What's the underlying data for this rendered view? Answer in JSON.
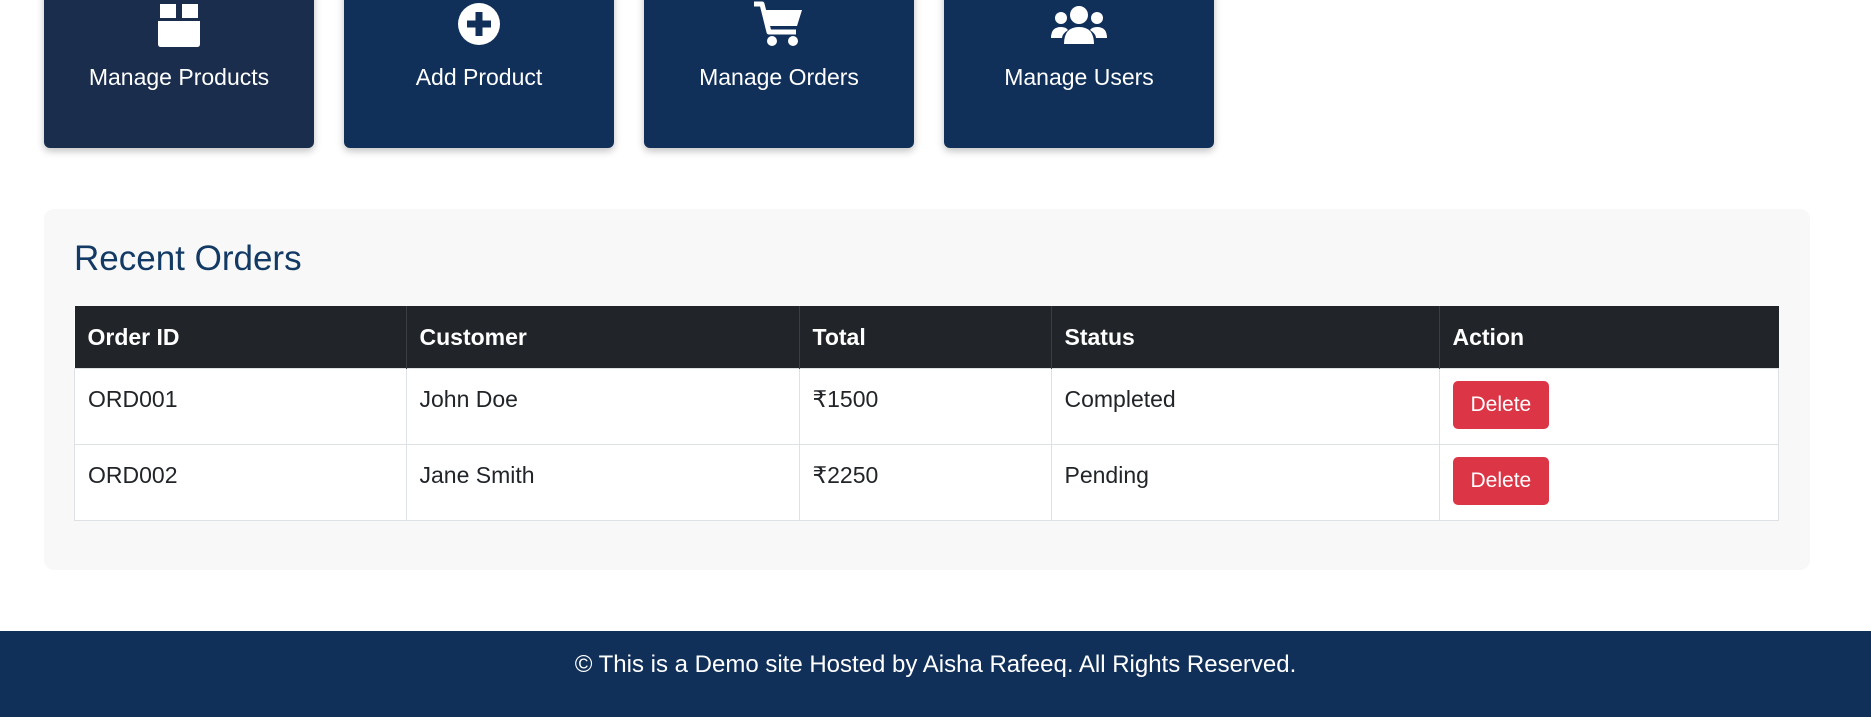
{
  "dashboard": {
    "cards": [
      {
        "label": "Manage Products",
        "icon": "box-icon"
      },
      {
        "label": "Add Product",
        "icon": "plus-circle-icon"
      },
      {
        "label": "Manage Orders",
        "icon": "cart-icon"
      },
      {
        "label": "Manage Users",
        "icon": "users-icon"
      }
    ]
  },
  "recent_orders": {
    "title": "Recent Orders",
    "columns": [
      "Order ID",
      "Customer",
      "Total",
      "Status",
      "Action"
    ],
    "rows": [
      {
        "order_id": "ORD001",
        "customer": "John Doe",
        "total": "₹1500",
        "status": "Completed",
        "action": "Delete"
      },
      {
        "order_id": "ORD002",
        "customer": "Jane Smith",
        "total": "₹2250",
        "status": "Pending",
        "action": "Delete"
      }
    ]
  },
  "footer": {
    "text": "© This is a Demo site Hosted by Aisha Rafeeq. All Rights Reserved."
  },
  "colors": {
    "card_bg": "#10305a",
    "table_header_bg": "#212529",
    "delete_button": "#dc3545",
    "heading": "#123a64"
  }
}
